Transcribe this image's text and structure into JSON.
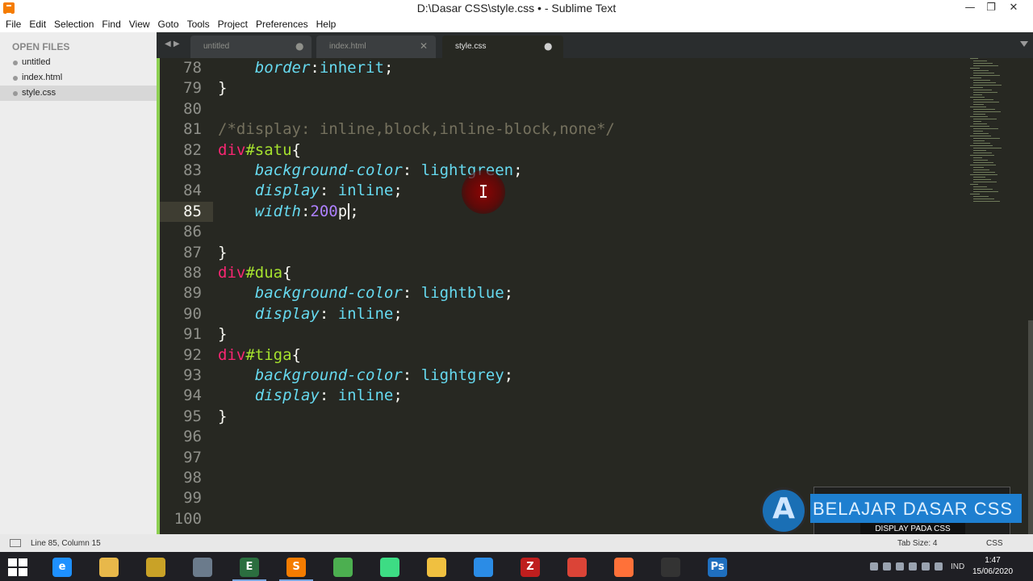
{
  "window": {
    "title": "D:\\Dasar CSS\\style.css • - Sublime Text"
  },
  "menu": [
    "File",
    "Edit",
    "Selection",
    "Find",
    "View",
    "Goto",
    "Tools",
    "Project",
    "Preferences",
    "Help"
  ],
  "sidebar": {
    "heading": "OPEN FILES",
    "files": [
      {
        "label": "untitled",
        "active": false
      },
      {
        "label": "index.html",
        "active": false
      },
      {
        "label": "style.css",
        "active": true
      }
    ]
  },
  "tabs": [
    {
      "label": "untitled",
      "state": "modified"
    },
    {
      "label": "index.html",
      "state": "close"
    },
    {
      "label": "style.css",
      "state": "modified",
      "active": true
    }
  ],
  "editor": {
    "line_numbers": [
      "78",
      "79",
      "80",
      "81",
      "82",
      "83",
      "84",
      "85",
      "86",
      "87",
      "88",
      "89",
      "90",
      "91",
      "92",
      "93",
      "94",
      "95",
      "96",
      "97",
      "98",
      "99",
      "100"
    ],
    "current_line": "85",
    "code": [
      {
        "indent": "    ",
        "parts": [
          [
            "prop",
            "border"
          ],
          [
            "plain",
            ":"
          ],
          [
            "val",
            "inherit"
          ],
          [
            "plain",
            ";"
          ]
        ]
      },
      {
        "indent": "",
        "parts": [
          [
            "plain",
            "}"
          ]
        ]
      },
      {
        "indent": "",
        "parts": []
      },
      {
        "indent": "",
        "parts": [
          [
            "com",
            "/*display: inline,block,inline-block,none*/"
          ]
        ]
      },
      {
        "indent": "",
        "parts": [
          [
            "sel",
            "div"
          ],
          [
            "id",
            "#satu"
          ],
          [
            "plain",
            "{"
          ]
        ]
      },
      {
        "indent": "    ",
        "parts": [
          [
            "prop",
            "background-color"
          ],
          [
            "plain",
            ": "
          ],
          [
            "val",
            "lightgreen"
          ],
          [
            "plain",
            ";"
          ]
        ]
      },
      {
        "indent": "    ",
        "parts": [
          [
            "prop",
            "display"
          ],
          [
            "plain",
            ": "
          ],
          [
            "val",
            "inline"
          ],
          [
            "plain",
            ";"
          ]
        ]
      },
      {
        "indent": "    ",
        "parts": [
          [
            "prop",
            "width"
          ],
          [
            "plain",
            ":"
          ],
          [
            "num",
            "200"
          ],
          [
            "plain",
            "p"
          ],
          [
            "caret",
            ""
          ],
          [
            "plain",
            ";"
          ]
        ]
      },
      {
        "indent": "",
        "parts": []
      },
      {
        "indent": "",
        "parts": [
          [
            "plain",
            "}"
          ]
        ]
      },
      {
        "indent": "",
        "parts": [
          [
            "sel",
            "div"
          ],
          [
            "id",
            "#dua"
          ],
          [
            "plain",
            "{"
          ]
        ]
      },
      {
        "indent": "    ",
        "parts": [
          [
            "prop",
            "background-color"
          ],
          [
            "plain",
            ": "
          ],
          [
            "val",
            "lightblue"
          ],
          [
            "plain",
            ";"
          ]
        ]
      },
      {
        "indent": "    ",
        "parts": [
          [
            "prop",
            "display"
          ],
          [
            "plain",
            ": "
          ],
          [
            "val",
            "inline"
          ],
          [
            "plain",
            ";"
          ]
        ]
      },
      {
        "indent": "",
        "parts": [
          [
            "plain",
            "}"
          ]
        ]
      },
      {
        "indent": "",
        "parts": [
          [
            "sel",
            "div"
          ],
          [
            "id",
            "#tiga"
          ],
          [
            "plain",
            "{"
          ]
        ]
      },
      {
        "indent": "    ",
        "parts": [
          [
            "prop",
            "background-color"
          ],
          [
            "plain",
            ": "
          ],
          [
            "val",
            "lightgrey"
          ],
          [
            "plain",
            ";"
          ]
        ]
      },
      {
        "indent": "    ",
        "parts": [
          [
            "prop",
            "display"
          ],
          [
            "plain",
            ": "
          ],
          [
            "val",
            "inline"
          ],
          [
            "plain",
            ";"
          ]
        ]
      },
      {
        "indent": "",
        "parts": [
          [
            "plain",
            "}"
          ]
        ]
      },
      {
        "indent": "",
        "parts": []
      },
      {
        "indent": "",
        "parts": []
      },
      {
        "indent": "",
        "parts": []
      },
      {
        "indent": "",
        "parts": []
      },
      {
        "indent": "",
        "parts": []
      }
    ]
  },
  "watermark": {
    "title": "BELAJAR DASAR CSS",
    "subtitle": "DISPLAY PADA CSS",
    "logo_letter": "A"
  },
  "statusbar": {
    "position": "Line 85, Column 15",
    "tab_size": "Tab Size: 4",
    "syntax": "CSS"
  },
  "taskbar": {
    "apps": [
      {
        "icon": "internet-explorer-icon",
        "glyph": "e",
        "color": "#1e90ff"
      },
      {
        "icon": "file-explorer-icon",
        "glyph": "",
        "color": "#e8b84a"
      },
      {
        "icon": "paint-icon",
        "glyph": "",
        "color": "#c9a227"
      },
      {
        "icon": "calculator-icon",
        "glyph": "",
        "color": "#6b7b8c"
      },
      {
        "icon": "text-editor-icon",
        "glyph": "E",
        "color": "#2b6e3f"
      },
      {
        "icon": "sublime-text-icon",
        "glyph": "S",
        "color": "#f57c00"
      },
      {
        "icon": "spreadsheet-icon",
        "glyph": "",
        "color": "#4caf50"
      },
      {
        "icon": "android-studio-icon",
        "glyph": "",
        "color": "#3ddc84"
      },
      {
        "icon": "mail-icon",
        "glyph": "",
        "color": "#f0c040"
      },
      {
        "icon": "vscode-icon",
        "glyph": "",
        "color": "#2b8ce6"
      },
      {
        "icon": "filezilla-icon",
        "glyph": "Z",
        "color": "#bf1e1e"
      },
      {
        "icon": "chrome-icon",
        "glyph": "",
        "color": "#db4437"
      },
      {
        "icon": "firefox-icon",
        "glyph": "",
        "color": "#ff7139"
      },
      {
        "icon": "video-editor-icon",
        "glyph": "",
        "color": "#333333"
      },
      {
        "icon": "photoshop-icon",
        "glyph": "Ps",
        "color": "#1f6fbf"
      }
    ],
    "language": "IND",
    "time": "1:47",
    "date": "15/06/2020"
  }
}
